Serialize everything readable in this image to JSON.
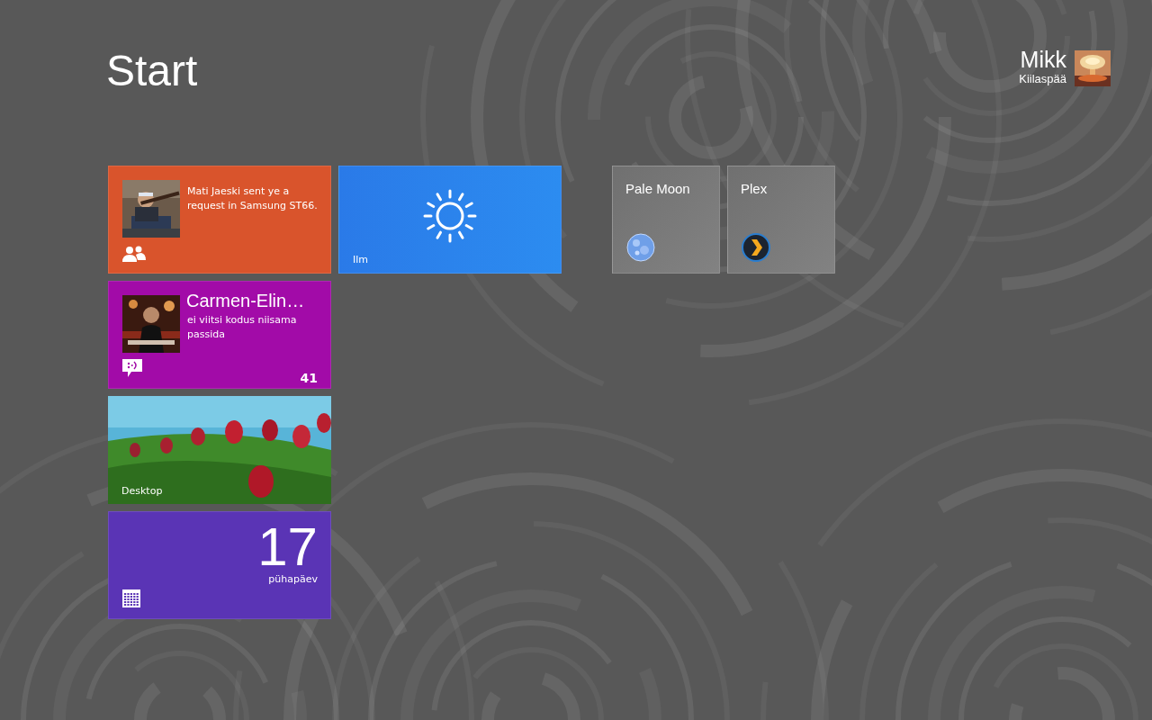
{
  "header": {
    "title": "Start"
  },
  "user": {
    "name": "Mikk",
    "surname": "Kiilaspää"
  },
  "groups": [
    {
      "columns": [
        {
          "tiles": [
            {
              "kind": "people",
              "color": "#d9542c",
              "message": "Mati Jaeski sent ye a request in Samsung ST66."
            },
            {
              "kind": "messaging",
              "color": "#a20ba8",
              "sender": "Carmen-Elin…",
              "message": "ei viitsi kodus niisama passida",
              "count": "41"
            },
            {
              "kind": "desktop",
              "label": "Desktop"
            },
            {
              "kind": "calendar",
              "color": "#5a34b5",
              "day": "17",
              "weekday": "pühapäev"
            }
          ]
        },
        {
          "tiles": [
            {
              "kind": "weather",
              "color": "#2a7ae8",
              "label": "Ilm"
            }
          ]
        }
      ]
    },
    {
      "columns": [
        {
          "tiles": [
            {
              "kind": "browser",
              "color": "#707070",
              "label": "Pale Moon"
            }
          ]
        },
        {
          "tiles": [
            {
              "kind": "media",
              "color": "#707070",
              "label": "Plex"
            }
          ]
        }
      ]
    }
  ]
}
